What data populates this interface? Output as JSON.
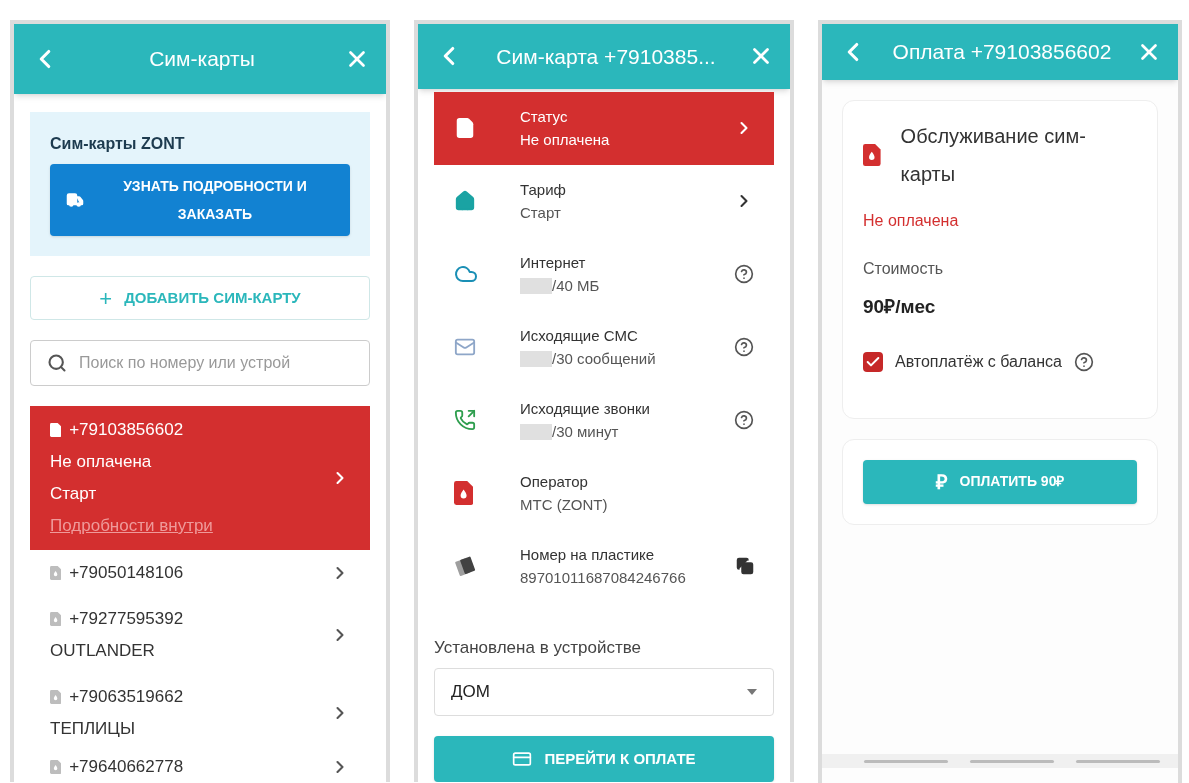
{
  "sim_list": {
    "header": {
      "title": "Сим-карты"
    },
    "promo": {
      "title": "Сим-карты ZONT",
      "button": "УЗНАТЬ ПОДРОБНОСТИ И ЗАКАЗАТЬ"
    },
    "add_button": {
      "icon": "+",
      "label": "ДОБАВИТЬ СИМ-КАРТУ"
    },
    "search": {
      "placeholder": "Поиск по номеру или устрой"
    },
    "sims": [
      {
        "number": "+79103856602",
        "lines": [
          "Не оплачена",
          "Старт"
        ],
        "link": "Подробности внутри",
        "selected": true
      },
      {
        "number": "+79050148106",
        "selected": false
      },
      {
        "number": "+79277595392",
        "lines": [
          "OUTLANDER"
        ],
        "selected": false
      },
      {
        "number": "+79063519662",
        "lines": [
          "ТЕПЛИЦЫ"
        ],
        "selected": false
      },
      {
        "number": "+79640662778",
        "selected": false
      }
    ]
  },
  "sim_details": {
    "header": {
      "title": "Сим-карта +7910385..."
    },
    "items": [
      {
        "kind": "nav",
        "label": "Статус",
        "value": "Не оплачена",
        "alert": true,
        "masked": false
      },
      {
        "kind": "nav",
        "label": "Тариф",
        "value": "Старт",
        "alert": false,
        "masked": false
      },
      {
        "kind": "help",
        "label": "Интернет",
        "value": "/40 МБ",
        "alert": false,
        "masked": true
      },
      {
        "kind": "help",
        "label": "Исходящие СМС",
        "value": "/30 сообщений",
        "alert": false,
        "masked": true
      },
      {
        "kind": "help",
        "label": "Исходящие звонки",
        "value": "/30 минут",
        "alert": false,
        "masked": true
      },
      {
        "kind": "info",
        "label": "Оператор",
        "value": "МТС (ZONT)",
        "alert": false,
        "masked": false
      },
      {
        "kind": "copy",
        "label": "Номер на пластике",
        "value": "89701011687084246766",
        "alert": false,
        "masked": false
      }
    ],
    "device": {
      "label": "Установлена в устройстве",
      "value": "ДОМ"
    },
    "pay_button": "ПЕРЕЙТИ К ОПЛАТЕ"
  },
  "payment": {
    "header": {
      "title": "Оплата +79103856602"
    },
    "title": "Обслуживание сим-карты",
    "status": "Не оплачена",
    "cost_label": "Стоимость",
    "cost": "90₽/мес",
    "autopay": {
      "label": "Автоплатёж с баланса",
      "checked": true
    },
    "pay_button": {
      "icon": "₽",
      "label": "ОПЛАТИТЬ 90₽"
    }
  }
}
